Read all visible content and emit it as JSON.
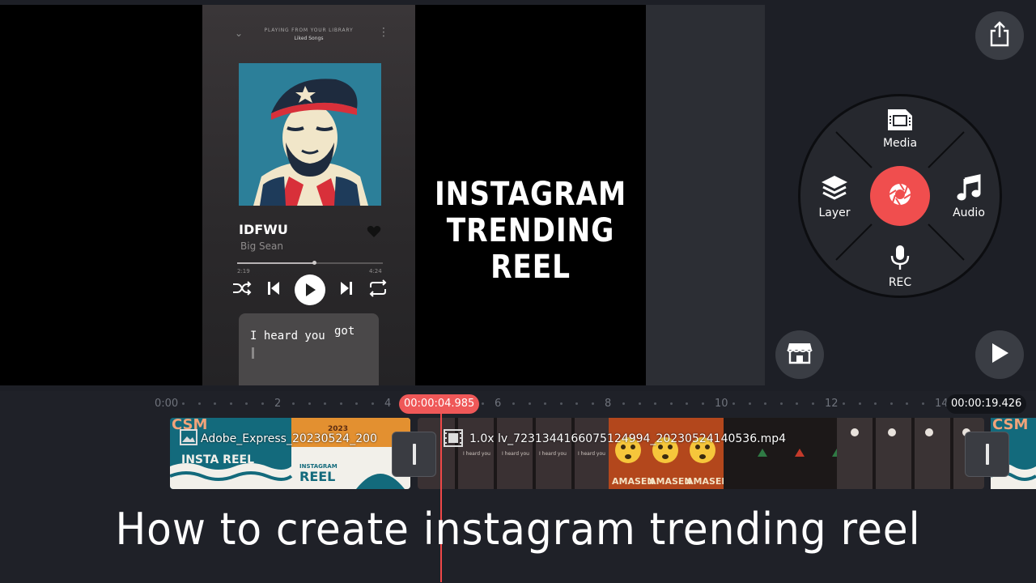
{
  "preview": {
    "player": {
      "header_line1": "PLAYING FROM YOUR LIBRARY",
      "header_line2": "Liked Songs",
      "song_title": "IDFWU",
      "artist": "Big Sean",
      "time_elapsed": "2:19",
      "time_total": "4:24",
      "progress_fraction": 0.53,
      "lyric_1": "I heard you",
      "lyric_2": "got"
    },
    "reel_title_lines": [
      "INSTAGRAM",
      "TRENDING",
      "REEL"
    ]
  },
  "wheel": {
    "media_label": "Media",
    "layer_label": "Layer",
    "audio_label": "Audio",
    "rec_label": "REC",
    "record_color": "#f04e4e"
  },
  "timeline": {
    "ruler_labels": [
      "0:00",
      "2",
      "4",
      "6",
      "8",
      "10",
      "12",
      "14"
    ],
    "current_time": "00:00:04.985",
    "total_time": "00:00:19.426",
    "accent_color": "#ef5858",
    "clip1_name": "Adobe_Express_20230524_200",
    "clip2_name": "1.0x lv_7231344166075124994_20230524140536.mp4",
    "clip1_thumb_text": "CSM",
    "clip1_thumb_year": "2023",
    "clip1_thumb_small": "INSTAGRAM",
    "clip1_thumb_big": "INSTA REEL",
    "clip1_thumb_sub": "INSTAGRAM",
    "clip1_thumb_big2": "REEL",
    "clip2_frame_text": "I heard you",
    "clip2_fire_text": "AMASEN",
    "clip3_thumb_text": "CSM"
  },
  "caption": "How to create instagram trending reel",
  "icons": {
    "share": "share-icon",
    "media": "film-icon",
    "layer": "layers-icon",
    "audio": "music-note-icon",
    "rec": "microphone-icon",
    "record": "camera-shutter-icon",
    "store": "store-icon",
    "play": "play-icon"
  }
}
